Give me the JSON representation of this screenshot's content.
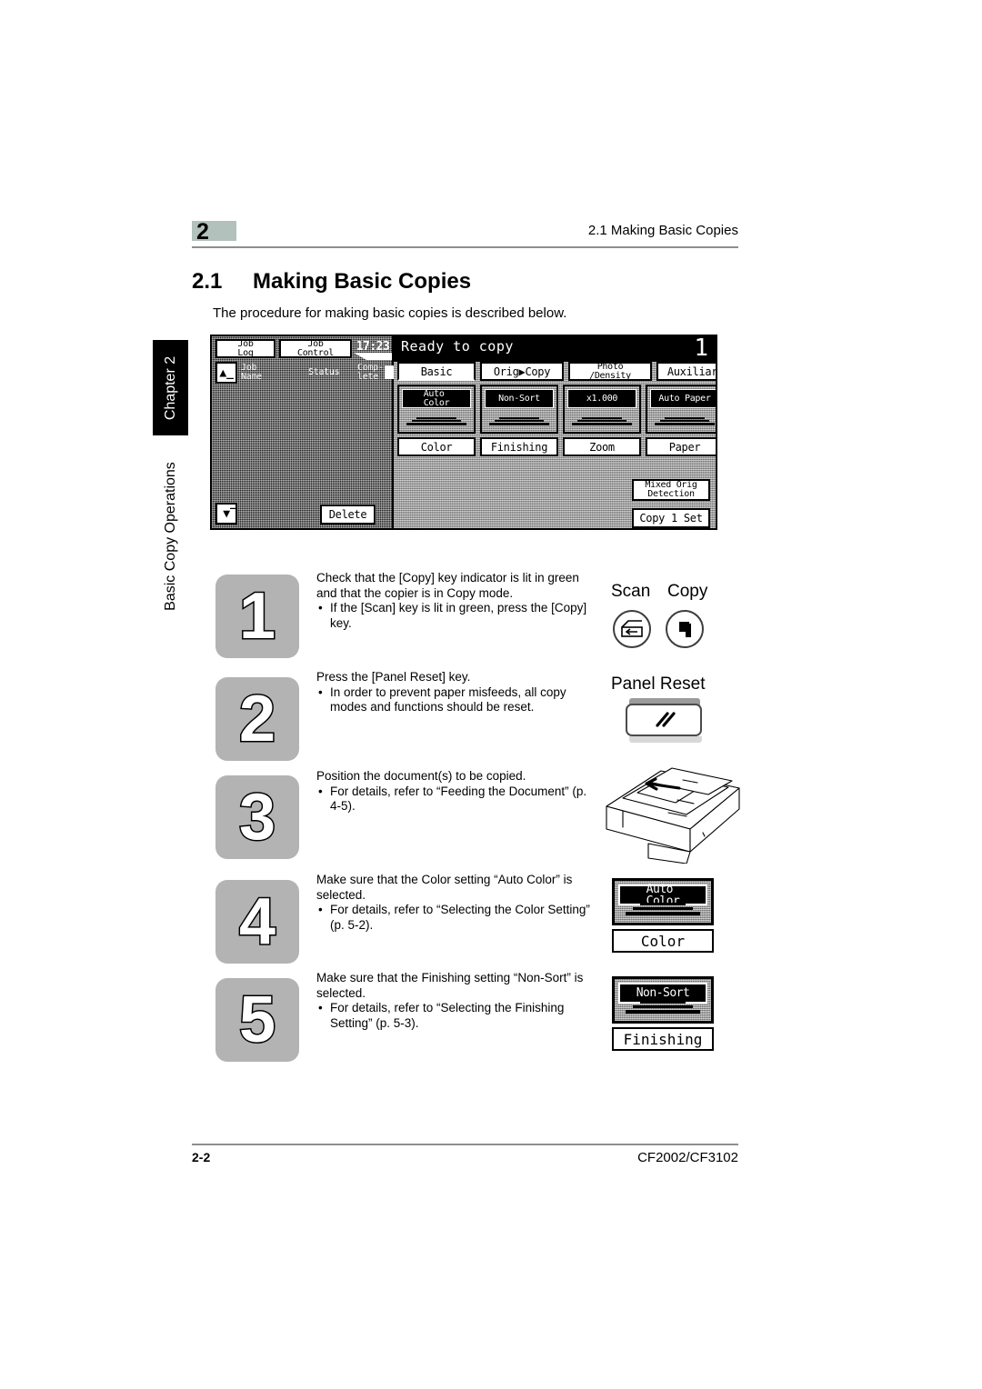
{
  "header": {
    "chapter_number": "2",
    "running_title": "2.1 Making Basic Copies"
  },
  "section": {
    "number": "2.1",
    "title": "Making Basic Copies",
    "intro": "The procedure for making basic copies is described below."
  },
  "spine": {
    "chapter_tab": "Chapter 2",
    "chapter_name": "Basic Copy Operations"
  },
  "lcd": {
    "job_log_label": "Job\nLog",
    "job_control_label": "Job\nControl",
    "clock": "17:23",
    "scroll_up_icon": "scroll-up-icon",
    "scroll_down_icon": "scroll-down-icon",
    "list_headers": [
      "Job\nName",
      "Status",
      "Comp-\nlete"
    ],
    "delete_label": "Delete",
    "status_text": "Ready to copy",
    "copy_count": "1",
    "tabs": [
      {
        "label": "Basic",
        "selected": true
      },
      {
        "label": "Orig▶Copy",
        "selected": false
      },
      {
        "label": "Photo\n/Density",
        "selected": false
      },
      {
        "label": "Auxiliary",
        "selected": false
      }
    ],
    "options": [
      {
        "value": "Auto\nColor",
        "label": "Color"
      },
      {
        "value": "Non-Sort",
        "label": "Finishing"
      },
      {
        "value": "x1.000",
        "label": "Zoom"
      },
      {
        "value": "Auto Paper",
        "label": "Paper"
      }
    ],
    "mixed_orig_label": "Mixed Orig\nDetection",
    "copy_set_label": "Copy 1 Set"
  },
  "steps": [
    {
      "number": "1",
      "lead": "Check that the [Copy] key indicator is lit in green and that the copier is in Copy mode.",
      "bullets": [
        "If the [Scan] key is lit in green, press the [Copy] key."
      ]
    },
    {
      "number": "2",
      "lead": "Press the [Panel Reset] key.",
      "bullets": [
        "In order to prevent paper misfeeds, all copy modes and functions should be reset."
      ]
    },
    {
      "number": "3",
      "lead": "Position the document(s) to be copied.",
      "bullets": [
        "For details, refer to “Feeding the Document” (p. 4-5)."
      ]
    },
    {
      "number": "4",
      "lead": "Make sure that the Color setting “Auto Color” is selected.",
      "bullets": [
        "For details, refer to “Selecting the Color Setting” (p. 5-2)."
      ]
    },
    {
      "number": "5",
      "lead": "Make sure that the Finishing setting “Non-Sort” is selected.",
      "bullets": [
        "For details, refer to “Selecting the Finishing Setting” (p. 5-3)."
      ]
    }
  ],
  "illustrations": {
    "scan_key_label": "Scan",
    "copy_key_label": "Copy",
    "panel_reset_label": "Panel Reset",
    "auto_color_value": "Auto\nColor",
    "auto_color_label": "Color",
    "non_sort_value": "Non-Sort",
    "non_sort_label": "Finishing"
  },
  "footer": {
    "page_number": "2-2",
    "model": "CF2002/CF3102"
  },
  "colors": {
    "chapter_badge": "#b2c1bb",
    "rule": "#8e8e8e",
    "step_box": "#b3b3b3",
    "tab_black": "#000000"
  }
}
